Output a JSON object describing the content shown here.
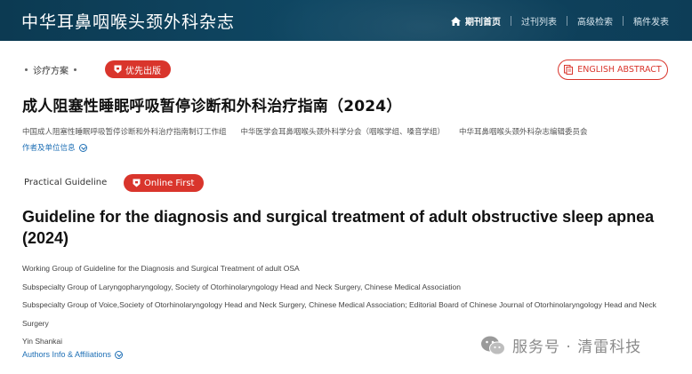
{
  "header": {
    "site_title": "中华耳鼻咽喉头颈外科杂志",
    "nav": [
      {
        "label": "期刊首页",
        "icon": "home-icon",
        "active": true
      },
      {
        "label": "过刊列表"
      },
      {
        "label": "高级检索"
      },
      {
        "label": "稿件发表"
      }
    ]
  },
  "cn": {
    "article_type": "诊疗方案",
    "badge": "优先出版",
    "abstract_button": "ENGLISH ABSTRACT",
    "title": "成人阻塞性睡眠呼吸暂停诊断和外科治疗指南（2024）",
    "authors": [
      "中国成人阻塞性睡眠呼吸暂停诊断和外科治疗指南制订工作组",
      "中华医学会耳鼻咽喉头颈外科学分会（咽喉学组、嗓音学组）",
      "中华耳鼻咽喉头颈外科杂志编辑委员会"
    ],
    "info_link": "作者及单位信息"
  },
  "en": {
    "article_type": "Practical Guideline",
    "badge": "Online First",
    "title": "Guideline for the diagnosis and surgical treatment of adult obstructive sleep apnea (2024)",
    "authors": [
      "Working Group of Guideline for the Diagnosis and Surgical Treatment of adult OSA",
      "Subspecialty Group of Laryngopharyngology, Society of Otorhinolaryngology Head and Neck Surgery, Chinese Medical Association",
      "Subspecialty Group of Voice,Society of Otorhinolaryngology Head and Neck Surgery, Chinese Medical Association; Editorial Board of Chinese Journal of Otorhinolaryngology Head and Neck Surgery",
      "Yin Shankai"
    ],
    "info_link": "Authors Info & Affiliations"
  },
  "watermark": {
    "text": "服务号 · 清雷科技",
    "icon": "wechat-icon"
  },
  "colors": {
    "header_bg": "#0f4763",
    "accent_red": "#d9352c",
    "link_blue": "#1e6fb5"
  }
}
